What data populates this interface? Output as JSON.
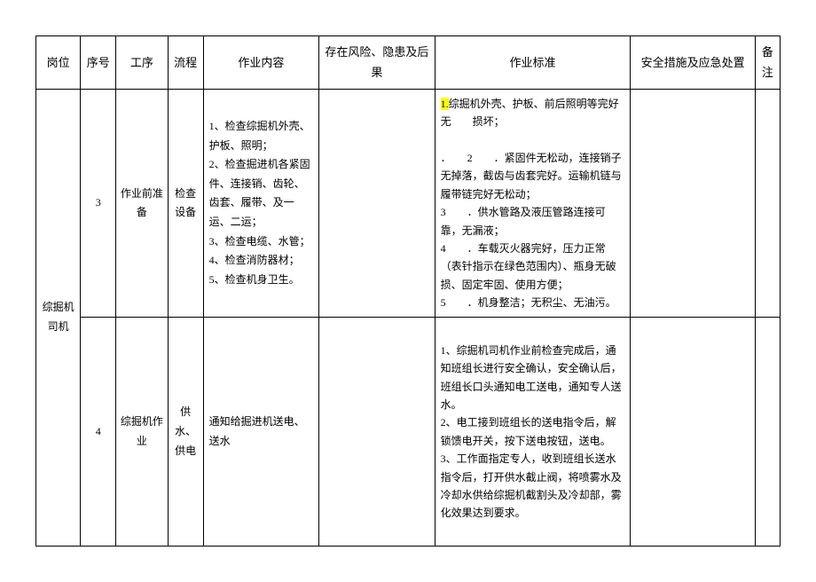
{
  "headers": {
    "position": "岗位",
    "seq": "序号",
    "process": "工序",
    "flow": "流程",
    "content": "作业内容",
    "risks": "存在风险、隐患及后果",
    "standard": "作业标准",
    "safety": "安全措施及应急处置",
    "remark": "备注"
  },
  "position": "综掘机司机",
  "rows": [
    {
      "seq": "3",
      "process": "作业前准备",
      "flow": "检查设备",
      "content_lines": [
        "1、检查综掘机外壳、护板、照明；",
        "2、检查掘进机各紧固件、连接销、齿轮、齿套、履带、及一运、二运；",
        "3、检查电缆、水管；4、检查消防器材；",
        "5、检查机身卫生。"
      ],
      "risks": "",
      "std_highlight_prefix": "1.",
      "std_highlight_rest": "综掘机外壳、护板、前后照明等完好无　　损坏；",
      "std_lines": [
        "．　　2　　．紧固件无松动，连接销子无掉落，截齿与齿套完好。运输机链与履带链完好无松动；",
        "3　　．供水管路及液压管路连接可靠，无漏液；",
        "4　　．车载灭火器完好，压力正常（表针指示在绿色范围内）、瓶身无破损、固定牢固、使用方便；",
        "5　　．机身整洁；无积尘、无油污。"
      ],
      "safety": "",
      "remark": ""
    },
    {
      "seq": "4",
      "process": "综掘机作业",
      "flow": "供水、供电",
      "content_single": "通知给掘进机送电、送水",
      "risks": "",
      "std_lines": [
        "1、综掘机司机作业前检查完成后，通知班组长进行安全确认，安全确认后，班组长口头通知电工送电，通知专人送水。",
        "2、电工接到班组长的送电指令后，解锁馈电开关，按下送电按钮，送电。",
        "3、工作面指定专人，收到班组长送水指令后，打开供水截止阀，将喷雾水及冷却水供给综掘机截割头及冷却部，雾化效果达到要求。"
      ],
      "safety": "",
      "remark": ""
    }
  ]
}
